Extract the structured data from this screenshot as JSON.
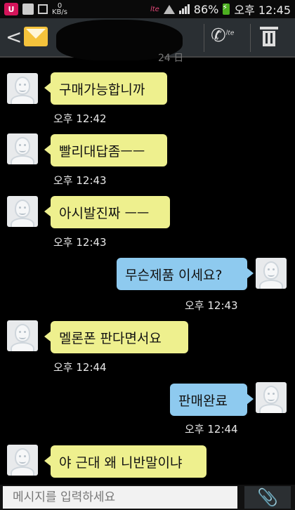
{
  "status_bar": {
    "network_speed": "0\nKB/s",
    "lte_label": "lte",
    "battery_percent": "86%",
    "clock": "오후 12:45"
  },
  "header": {
    "back_icon": "back-arrow-icon",
    "contact_icon": "envelope-icon",
    "call_badge": "lte"
  },
  "top_timestamp_fragment": "24 日",
  "messages": [
    {
      "direction": "in",
      "text": "구매가능합니까",
      "time": "오후 12:42"
    },
    {
      "direction": "in",
      "text": "빨리대답좀ㅡㅡ",
      "time": "오후 12:43"
    },
    {
      "direction": "in",
      "text": "아시발진짜 ㅡㅡ",
      "time": "오후 12:43"
    },
    {
      "direction": "out",
      "text": "무슨제품 이세요?",
      "time": "오후 12:43"
    },
    {
      "direction": "in",
      "text": "멜론폰 판다면서요",
      "time": "오후 12:44"
    },
    {
      "direction": "out",
      "text": "판매완료",
      "time": "오후 12:44"
    },
    {
      "direction": "in",
      "text": "야 근대 왜 니반말이냐",
      "time": ""
    }
  ],
  "composer": {
    "placeholder": "메시지를 입력하세요",
    "attach_icon": "paperclip-icon"
  },
  "colors": {
    "incoming_bubble": "#eef08e",
    "outgoing_bubble": "#8ecaef",
    "header_bg": "#2a2f33"
  }
}
